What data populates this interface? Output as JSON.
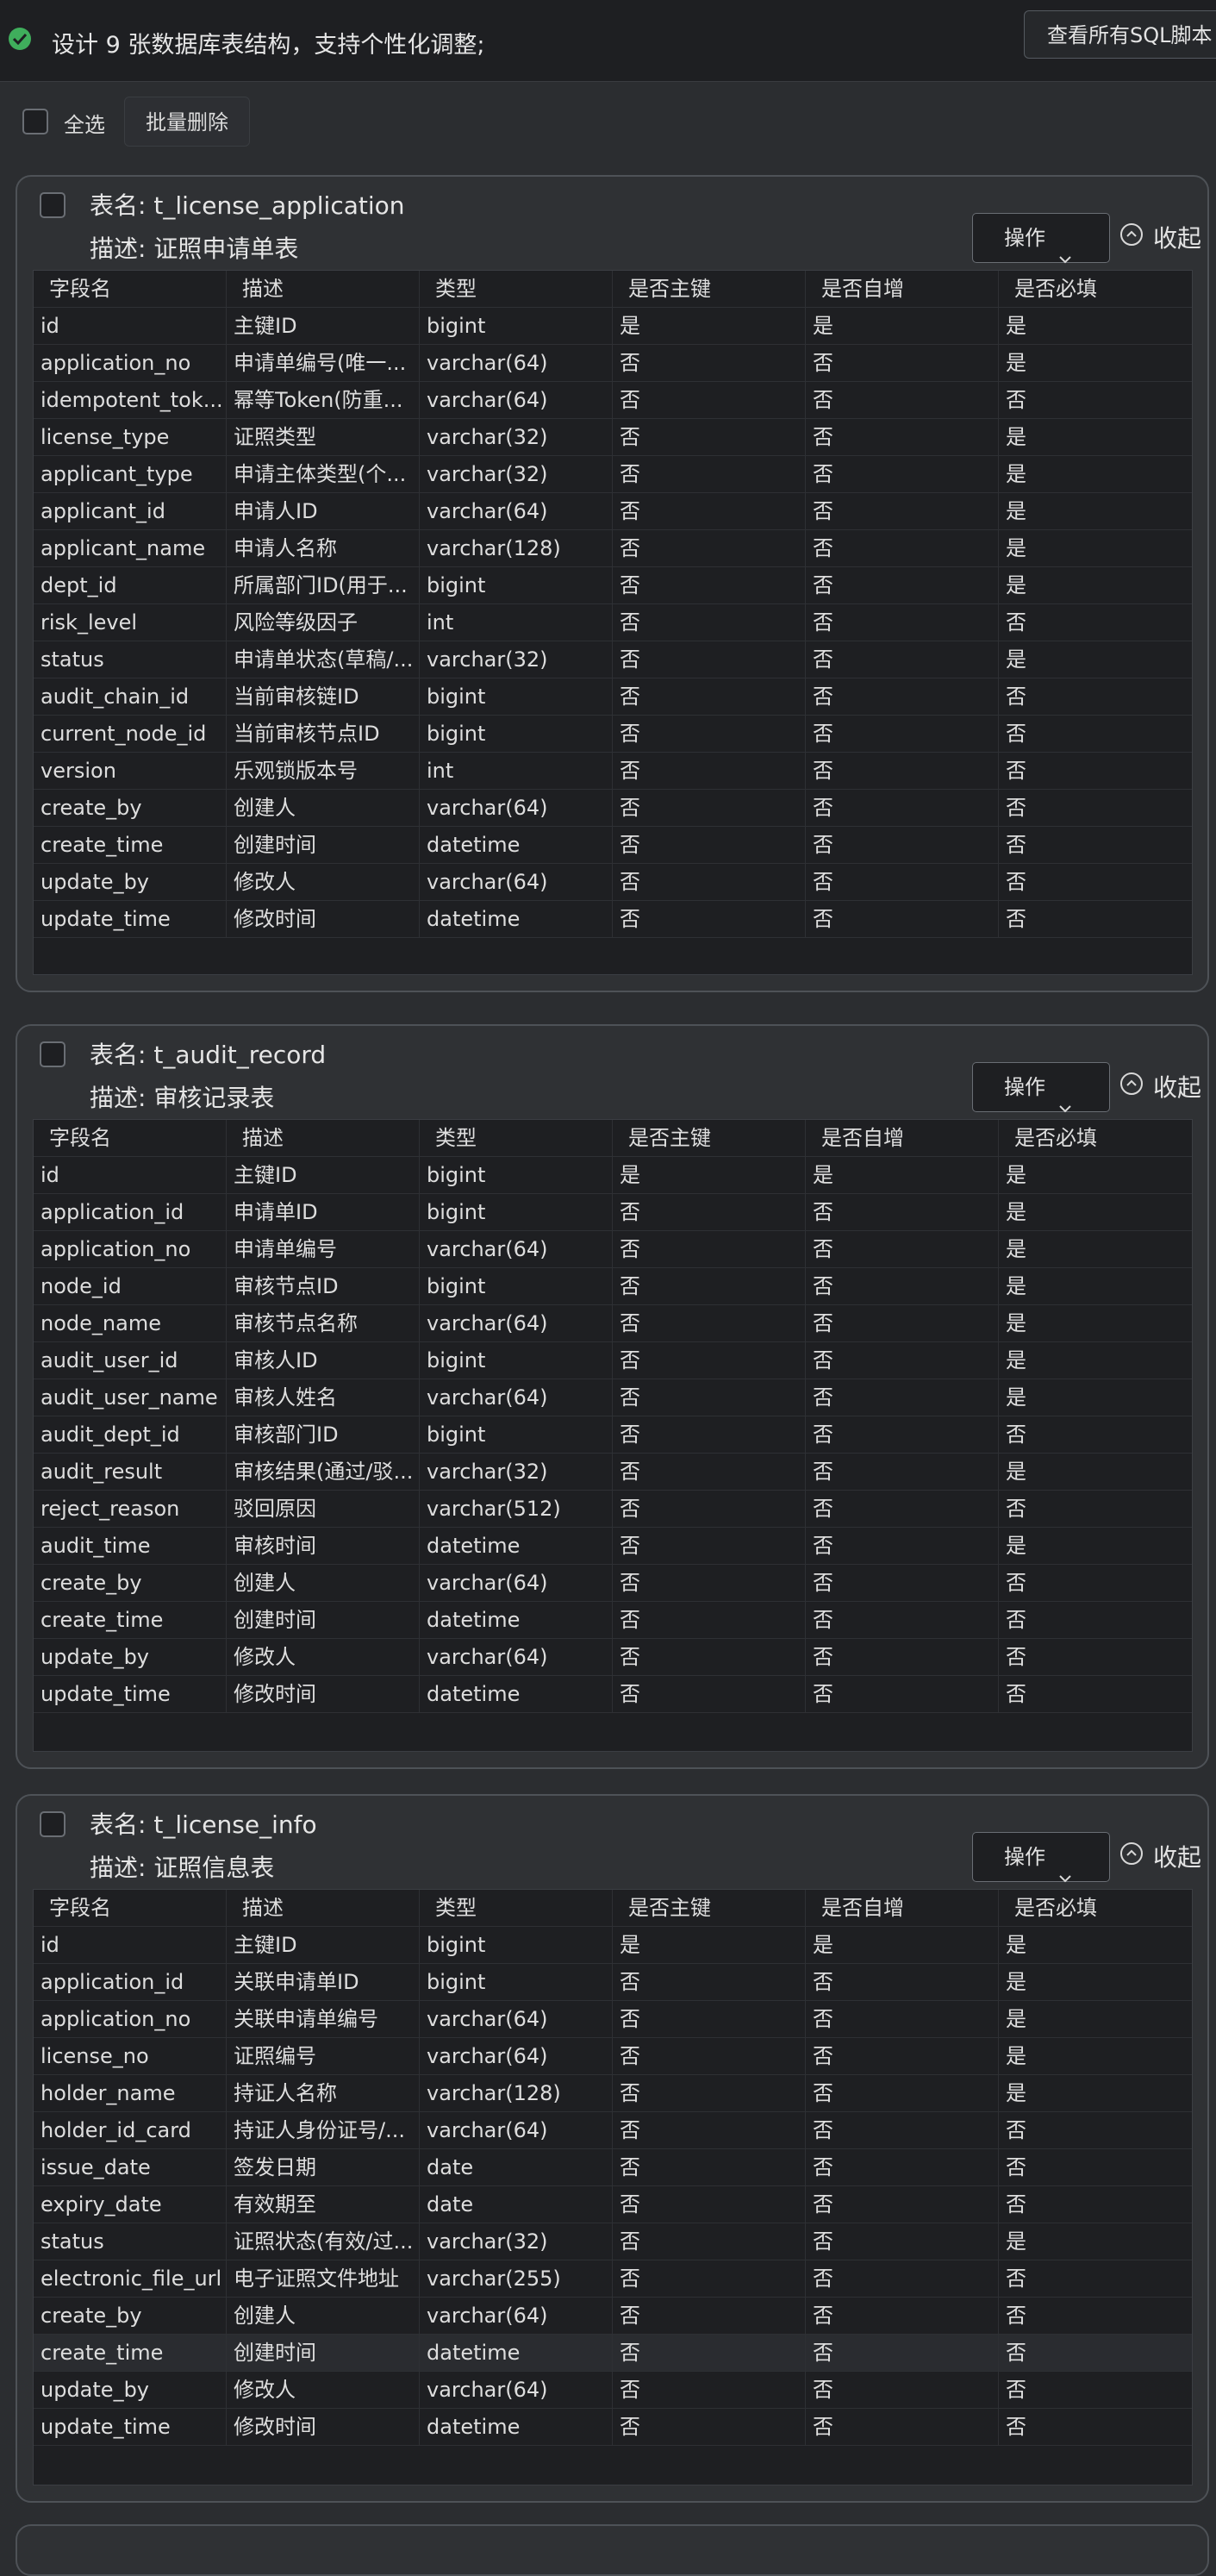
{
  "header": {
    "title": "设计 9 张数据库表结构，支持个性化调整;",
    "view_sql_label": "查看所有SQL脚本"
  },
  "toolbar": {
    "select_all_label": "全选",
    "batch_delete_label": "批量删除"
  },
  "card_labels": {
    "table_name_prefix": "表名: ",
    "desc_prefix": "描述: ",
    "operation_label": "操作",
    "collapse_label": "收起"
  },
  "columns": [
    "字段名",
    "描述",
    "类型",
    "是否主键",
    "是否自增",
    "是否必填"
  ],
  "tables": [
    {
      "name": "t_license_application",
      "description": "证照申请单表",
      "rows": [
        [
          "id",
          "主键ID",
          "bigint",
          "是",
          "是",
          "是"
        ],
        [
          "application_no",
          "申请单编号(唯一...",
          "varchar(64)",
          "否",
          "否",
          "是"
        ],
        [
          "idempotent_tok...",
          "幂等Token(防重...",
          "varchar(64)",
          "否",
          "否",
          "否"
        ],
        [
          "license_type",
          "证照类型",
          "varchar(32)",
          "否",
          "否",
          "是"
        ],
        [
          "applicant_type",
          "申请主体类型(个...",
          "varchar(32)",
          "否",
          "否",
          "是"
        ],
        [
          "applicant_id",
          "申请人ID",
          "varchar(64)",
          "否",
          "否",
          "是"
        ],
        [
          "applicant_name",
          "申请人名称",
          "varchar(128)",
          "否",
          "否",
          "是"
        ],
        [
          "dept_id",
          "所属部门ID(用于...",
          "bigint",
          "否",
          "否",
          "是"
        ],
        [
          "risk_level",
          "风险等级因子",
          "int",
          "否",
          "否",
          "否"
        ],
        [
          "status",
          "申请单状态(草稿/...",
          "varchar(32)",
          "否",
          "否",
          "是"
        ],
        [
          "audit_chain_id",
          "当前审核链ID",
          "bigint",
          "否",
          "否",
          "否"
        ],
        [
          "current_node_id",
          "当前审核节点ID",
          "bigint",
          "否",
          "否",
          "否"
        ],
        [
          "version",
          "乐观锁版本号",
          "int",
          "否",
          "否",
          "否"
        ],
        [
          "create_by",
          "创建人",
          "varchar(64)",
          "否",
          "否",
          "否"
        ],
        [
          "create_time",
          "创建时间",
          "datetime",
          "否",
          "否",
          "否"
        ],
        [
          "update_by",
          "修改人",
          "varchar(64)",
          "否",
          "否",
          "否"
        ],
        [
          "update_time",
          "修改时间",
          "datetime",
          "否",
          "否",
          "否"
        ]
      ]
    },
    {
      "name": "t_audit_record",
      "description": "审核记录表",
      "rows": [
        [
          "id",
          "主键ID",
          "bigint",
          "是",
          "是",
          "是"
        ],
        [
          "application_id",
          "申请单ID",
          "bigint",
          "否",
          "否",
          "是"
        ],
        [
          "application_no",
          "申请单编号",
          "varchar(64)",
          "否",
          "否",
          "是"
        ],
        [
          "node_id",
          "审核节点ID",
          "bigint",
          "否",
          "否",
          "是"
        ],
        [
          "node_name",
          "审核节点名称",
          "varchar(64)",
          "否",
          "否",
          "是"
        ],
        [
          "audit_user_id",
          "审核人ID",
          "bigint",
          "否",
          "否",
          "是"
        ],
        [
          "audit_user_name",
          "审核人姓名",
          "varchar(64)",
          "否",
          "否",
          "是"
        ],
        [
          "audit_dept_id",
          "审核部门ID",
          "bigint",
          "否",
          "否",
          "否"
        ],
        [
          "audit_result",
          "审核结果(通过/驳...",
          "varchar(32)",
          "否",
          "否",
          "是"
        ],
        [
          "reject_reason",
          "驳回原因",
          "varchar(512)",
          "否",
          "否",
          "否"
        ],
        [
          "audit_time",
          "审核时间",
          "datetime",
          "否",
          "否",
          "是"
        ],
        [
          "create_by",
          "创建人",
          "varchar(64)",
          "否",
          "否",
          "否"
        ],
        [
          "create_time",
          "创建时间",
          "datetime",
          "否",
          "否",
          "否"
        ],
        [
          "update_by",
          "修改人",
          "varchar(64)",
          "否",
          "否",
          "否"
        ],
        [
          "update_time",
          "修改时间",
          "datetime",
          "否",
          "否",
          "否"
        ]
      ]
    },
    {
      "name": "t_license_info",
      "description": "证照信息表",
      "highlight_row": 11,
      "rows": [
        [
          "id",
          "主键ID",
          "bigint",
          "是",
          "是",
          "是"
        ],
        [
          "application_id",
          "关联申请单ID",
          "bigint",
          "否",
          "否",
          "是"
        ],
        [
          "application_no",
          "关联申请单编号",
          "varchar(64)",
          "否",
          "否",
          "是"
        ],
        [
          "license_no",
          "证照编号",
          "varchar(64)",
          "否",
          "否",
          "是"
        ],
        [
          "holder_name",
          "持证人名称",
          "varchar(128)",
          "否",
          "否",
          "是"
        ],
        [
          "holder_id_card",
          "持证人身份证号/...",
          "varchar(64)",
          "否",
          "否",
          "否"
        ],
        [
          "issue_date",
          "签发日期",
          "date",
          "否",
          "否",
          "否"
        ],
        [
          "expiry_date",
          "有效期至",
          "date",
          "否",
          "否",
          "否"
        ],
        [
          "status",
          "证照状态(有效/过...",
          "varchar(32)",
          "否",
          "否",
          "是"
        ],
        [
          "electronic_file_url",
          "电子证照文件地址",
          "varchar(255)",
          "否",
          "否",
          "否"
        ],
        [
          "create_by",
          "创建人",
          "varchar(64)",
          "否",
          "否",
          "否"
        ],
        [
          "create_time",
          "创建时间",
          "datetime",
          "否",
          "否",
          "否"
        ],
        [
          "update_by",
          "修改人",
          "varchar(64)",
          "否",
          "否",
          "否"
        ],
        [
          "update_time",
          "修改时间",
          "datetime",
          "否",
          "否",
          "否"
        ]
      ]
    }
  ]
}
